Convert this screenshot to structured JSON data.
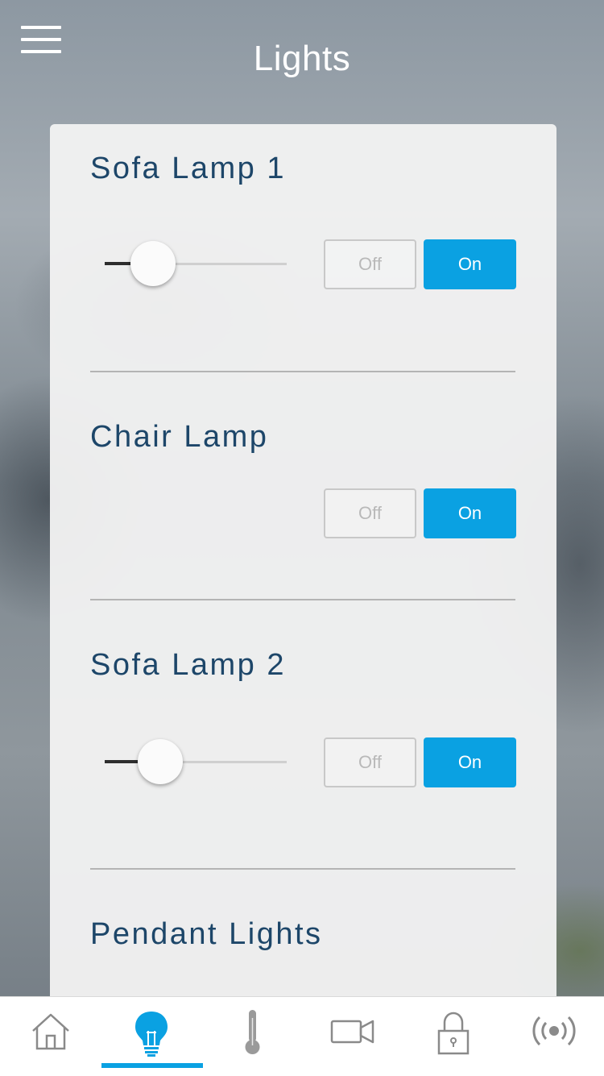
{
  "header": {
    "title": "Lights",
    "menu_icon": "hamburger-menu-icon"
  },
  "lights": [
    {
      "name": "Sofa Lamp 1",
      "has_dimmer": true,
      "dimmer_level": 0.22,
      "off_label": "Off",
      "on_label": "On",
      "state": "On"
    },
    {
      "name": "Chair Lamp",
      "has_dimmer": false,
      "off_label": "Off",
      "on_label": "On",
      "state": "On"
    },
    {
      "name": "Sofa Lamp 2",
      "has_dimmer": true,
      "dimmer_level": 0.26,
      "off_label": "Off",
      "on_label": "On",
      "state": "On"
    },
    {
      "name": "Pendant Lights"
    }
  ],
  "tabbar": {
    "tabs": [
      {
        "icon": "home-icon"
      },
      {
        "icon": "light-bulb-icon",
        "active": true
      },
      {
        "icon": "thermometer-icon"
      },
      {
        "icon": "video-camera-icon"
      },
      {
        "icon": "lock-icon"
      },
      {
        "icon": "wireless-signal-icon"
      }
    ]
  },
  "colors": {
    "accent": "#0aa1e2",
    "title_text": "#1d4669",
    "panel_bg": "#f1f1f1"
  }
}
